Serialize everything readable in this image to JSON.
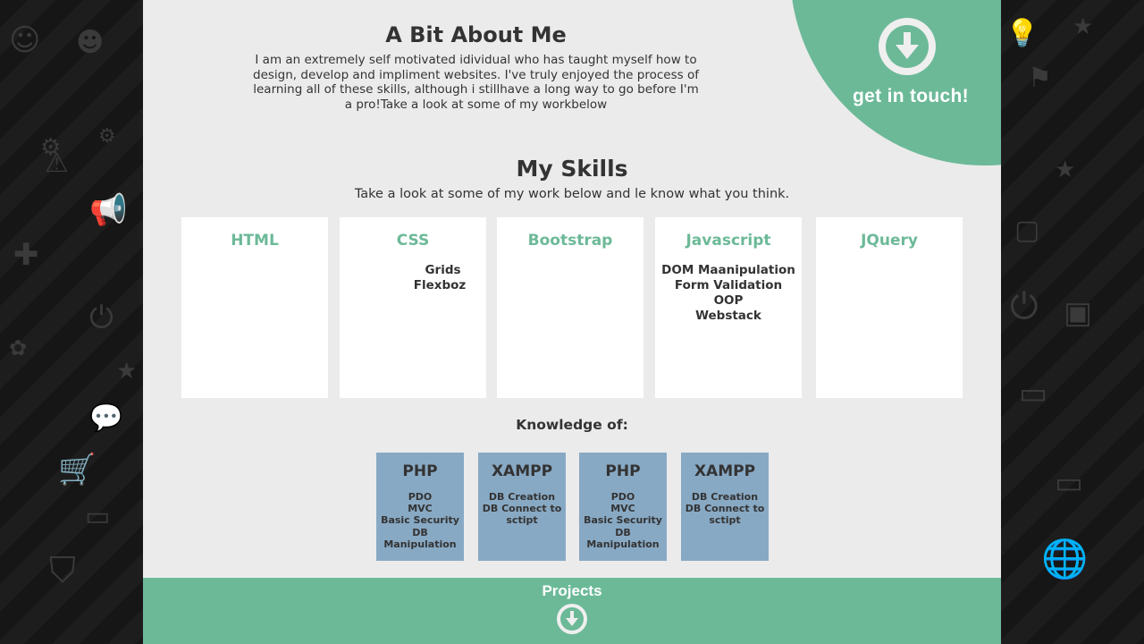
{
  "about": {
    "title": "A Bit About Me",
    "body": "I am an extremely self motivated idividual who has taught myself how to design, develop and impliment websites. I've truly enjoyed the process of learning all of these skills, although i stillhave a long way to go before I'm a pro!Take a look at some of my workbelow"
  },
  "contact": {
    "label": "get in touch!",
    "icon": "arrow-down-circle-icon"
  },
  "skills": {
    "title": "My Skills",
    "subtitle": "Take a look at some of my work below and le know what you think.",
    "cards": [
      {
        "title": "HTML",
        "items": []
      },
      {
        "title": "CSS",
        "items": [
          "Grids",
          "Flexboz"
        ]
      },
      {
        "title": "Bootstrap",
        "items": []
      },
      {
        "title": "Javascript",
        "items": [
          "DOM Maanipulation",
          "Form Validation",
          "OOP",
          "Webstack"
        ]
      },
      {
        "title": "JQuery",
        "items": []
      }
    ]
  },
  "knowledge": {
    "title": "Knowledge of:",
    "cards": [
      {
        "title": "PHP",
        "items": [
          "PDO",
          "MVC",
          "Basic Security",
          "DB Manipulation"
        ]
      },
      {
        "title": "XAMPP",
        "items": [
          "DB Creation",
          "DB Connect to sctipt"
        ]
      },
      {
        "title": "PHP",
        "items": [
          "PDO",
          "MVC",
          "Basic Security",
          "DB Manipulation"
        ]
      },
      {
        "title": "XAMPP",
        "items": [
          "DB Creation",
          "DB Connect to sctipt"
        ]
      }
    ]
  },
  "footer": {
    "label": "Projects",
    "icon": "arrow-down-circle-icon"
  },
  "colors": {
    "accent": "#6cb998",
    "knowledge_card": "#88a9c4",
    "page_bg": "#ebebeb",
    "text": "#333333"
  }
}
